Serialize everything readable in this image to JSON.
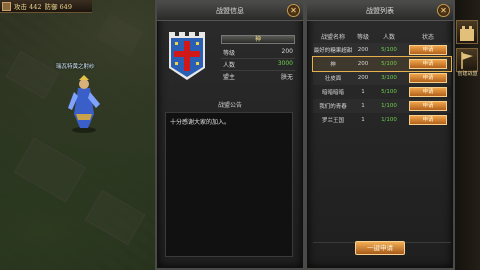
{
  "hud": {
    "attack_label": "攻击 442",
    "defense_label": "防御 649"
  },
  "player": {
    "name": "瑞瓦特黄之射纱"
  },
  "right_strip": {
    "label": "创建战盟"
  },
  "guild_info": {
    "title": "战盟信息",
    "guild_name": "神",
    "level_label": "等级",
    "level_value": "200",
    "members_label": "人数",
    "members_value": "3000",
    "leader_label": "盟主",
    "leader_value": "朕无",
    "notice_text": "十分感谢大家的加入。",
    "notice_title": "战盟公告",
    "close_glyph": "✕"
  },
  "guild_list": {
    "title": "战盟列表",
    "close_glyph": "✕",
    "headers": [
      "战盟名称",
      "等级",
      "人数",
      "状态"
    ],
    "apply_label": "申请",
    "rows": [
      {
        "name": "最好的糖果超甜",
        "level": "200",
        "members": "5/100",
        "selected": false
      },
      {
        "name": "神",
        "level": "200",
        "members": "5/100",
        "selected": true
      },
      {
        "name": "壮皮面",
        "level": "200",
        "members": "3/100",
        "selected": false
      },
      {
        "name": "暗暗暗暗",
        "level": "1",
        "members": "5/100",
        "selected": false
      },
      {
        "name": "我们的青春",
        "level": "1",
        "members": "1/100",
        "selected": false
      },
      {
        "name": "罗兰王国",
        "level": "1",
        "members": "1/100",
        "selected": false
      }
    ],
    "quick_apply_label": "一键申请"
  },
  "colors": {
    "accent_orange": "#e89a3c",
    "count_green": "#6fcf4d",
    "banner_blue": "#2a5fb4",
    "banner_red": "#d01818"
  }
}
